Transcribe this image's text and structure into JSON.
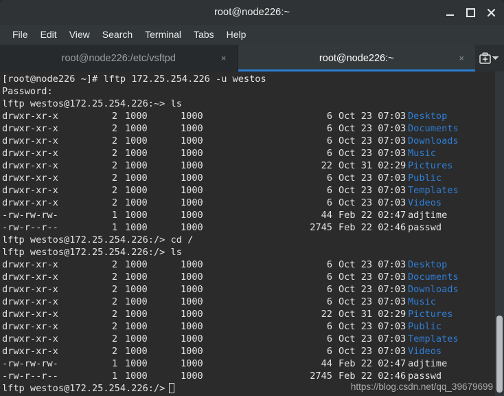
{
  "window": {
    "title": "root@node226:~",
    "buttons": {
      "minimize": "minimize",
      "maximize": "maximize",
      "close": "close"
    }
  },
  "menubar": {
    "items": [
      {
        "label": "File"
      },
      {
        "label": "Edit"
      },
      {
        "label": "View"
      },
      {
        "label": "Search"
      },
      {
        "label": "Terminal"
      },
      {
        "label": "Tabs"
      },
      {
        "label": "Help"
      }
    ]
  },
  "tabs": {
    "items": [
      {
        "label": "root@node226:/etc/vsftpd",
        "active": false,
        "close": "×"
      },
      {
        "label": "root@node226:~",
        "active": true,
        "close": "×"
      }
    ],
    "new_tab_label": "new-tab",
    "dropdown_label": "tab-list"
  },
  "colors": {
    "accent": "#2a7fd4",
    "directory": "#2f7fd8",
    "file": "#e4e4e4",
    "terminal_bg": "#2b2b2b",
    "titlebar_bg": "#2f3336"
  },
  "terminal": {
    "prompt_root": "[root@node226 ~]#",
    "prompt_home": "lftp westos@172.25.254.226:~>",
    "prompt_slash": "lftp westos@172.25.254.226:/>",
    "lines": [
      {
        "type": "command",
        "prompt": "[root@node226 ~]#",
        "command": " lftp 172.25.254.226 -u westos"
      },
      {
        "type": "text",
        "text": "Password:"
      },
      {
        "type": "command",
        "prompt": "lftp westos@172.25.254.226:~>",
        "command": " ls"
      },
      {
        "type": "listing",
        "perm": "drwxr-xr-x",
        "links": "2",
        "owner": "1000",
        "group": "1000",
        "size": "6",
        "date": "Oct 23 07:03",
        "name": "Desktop",
        "kind": "dir"
      },
      {
        "type": "listing",
        "perm": "drwxr-xr-x",
        "links": "2",
        "owner": "1000",
        "group": "1000",
        "size": "6",
        "date": "Oct 23 07:03",
        "name": "Documents",
        "kind": "dir"
      },
      {
        "type": "listing",
        "perm": "drwxr-xr-x",
        "links": "2",
        "owner": "1000",
        "group": "1000",
        "size": "6",
        "date": "Oct 23 07:03",
        "name": "Downloads",
        "kind": "dir"
      },
      {
        "type": "listing",
        "perm": "drwxr-xr-x",
        "links": "2",
        "owner": "1000",
        "group": "1000",
        "size": "6",
        "date": "Oct 23 07:03",
        "name": "Music",
        "kind": "dir"
      },
      {
        "type": "listing",
        "perm": "drwxr-xr-x",
        "links": "2",
        "owner": "1000",
        "group": "1000",
        "size": "22",
        "date": "Oct 31 02:29",
        "name": "Pictures",
        "kind": "dir"
      },
      {
        "type": "listing",
        "perm": "drwxr-xr-x",
        "links": "2",
        "owner": "1000",
        "group": "1000",
        "size": "6",
        "date": "Oct 23 07:03",
        "name": "Public",
        "kind": "dir"
      },
      {
        "type": "listing",
        "perm": "drwxr-xr-x",
        "links": "2",
        "owner": "1000",
        "group": "1000",
        "size": "6",
        "date": "Oct 23 07:03",
        "name": "Templates",
        "kind": "dir"
      },
      {
        "type": "listing",
        "perm": "drwxr-xr-x",
        "links": "2",
        "owner": "1000",
        "group": "1000",
        "size": "6",
        "date": "Oct 23 07:03",
        "name": "Videos",
        "kind": "dir"
      },
      {
        "type": "listing",
        "perm": "-rw-rw-rw-",
        "links": "1",
        "owner": "1000",
        "group": "1000",
        "size": "44",
        "date": "Feb 22 02:47",
        "name": "adjtime",
        "kind": "file"
      },
      {
        "type": "listing",
        "perm": "-rw-r--r--",
        "links": "1",
        "owner": "1000",
        "group": "1000",
        "size": "2745",
        "date": "Feb 22 02:46",
        "name": "passwd",
        "kind": "file"
      },
      {
        "type": "command",
        "prompt": "lftp westos@172.25.254.226:/>",
        "command": " cd /"
      },
      {
        "type": "command",
        "prompt": "lftp westos@172.25.254.226:/>",
        "command": " ls"
      },
      {
        "type": "listing",
        "perm": "drwxr-xr-x",
        "links": "2",
        "owner": "1000",
        "group": "1000",
        "size": "6",
        "date": "Oct 23 07:03",
        "name": "Desktop",
        "kind": "dir"
      },
      {
        "type": "listing",
        "perm": "drwxr-xr-x",
        "links": "2",
        "owner": "1000",
        "group": "1000",
        "size": "6",
        "date": "Oct 23 07:03",
        "name": "Documents",
        "kind": "dir"
      },
      {
        "type": "listing",
        "perm": "drwxr-xr-x",
        "links": "2",
        "owner": "1000",
        "group": "1000",
        "size": "6",
        "date": "Oct 23 07:03",
        "name": "Downloads",
        "kind": "dir"
      },
      {
        "type": "listing",
        "perm": "drwxr-xr-x",
        "links": "2",
        "owner": "1000",
        "group": "1000",
        "size": "6",
        "date": "Oct 23 07:03",
        "name": "Music",
        "kind": "dir"
      },
      {
        "type": "listing",
        "perm": "drwxr-xr-x",
        "links": "2",
        "owner": "1000",
        "group": "1000",
        "size": "22",
        "date": "Oct 31 02:29",
        "name": "Pictures",
        "kind": "dir"
      },
      {
        "type": "listing",
        "perm": "drwxr-xr-x",
        "links": "2",
        "owner": "1000",
        "group": "1000",
        "size": "6",
        "date": "Oct 23 07:03",
        "name": "Public",
        "kind": "dir"
      },
      {
        "type": "listing",
        "perm": "drwxr-xr-x",
        "links": "2",
        "owner": "1000",
        "group": "1000",
        "size": "6",
        "date": "Oct 23 07:03",
        "name": "Templates",
        "kind": "dir"
      },
      {
        "type": "listing",
        "perm": "drwxr-xr-x",
        "links": "2",
        "owner": "1000",
        "group": "1000",
        "size": "6",
        "date": "Oct 23 07:03",
        "name": "Videos",
        "kind": "dir"
      },
      {
        "type": "listing",
        "perm": "-rw-rw-rw-",
        "links": "1",
        "owner": "1000",
        "group": "1000",
        "size": "44",
        "date": "Feb 22 02:47",
        "name": "adjtime",
        "kind": "file"
      },
      {
        "type": "listing",
        "perm": "-rw-r--r--",
        "links": "1",
        "owner": "1000",
        "group": "1000",
        "size": "2745",
        "date": "Feb 22 02:46",
        "name": "passwd",
        "kind": "file"
      },
      {
        "type": "prompt_cursor",
        "prompt": "lftp westos@172.25.254.226:/>",
        "command": ""
      }
    ]
  },
  "watermark": {
    "text": "https://blog.csdn.net/qq_39679699"
  }
}
